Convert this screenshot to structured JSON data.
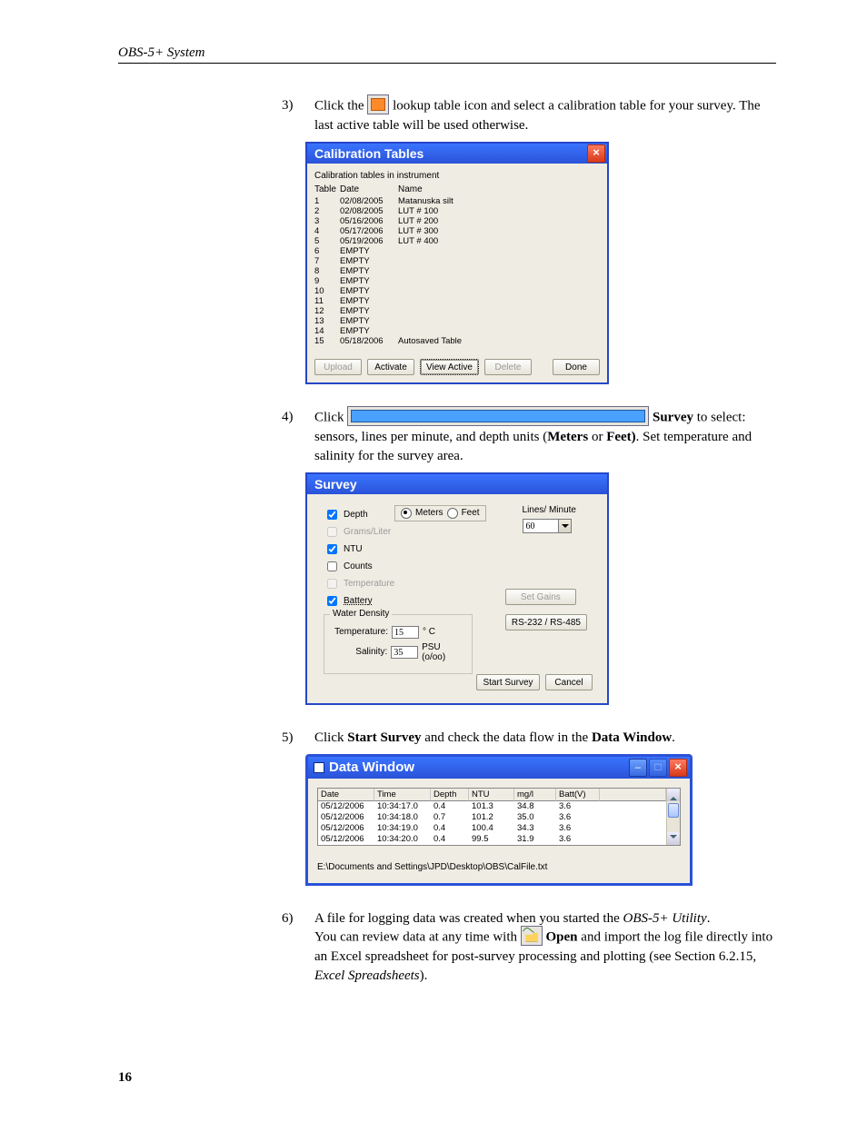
{
  "page": {
    "running_head": "OBS-5+ System",
    "page_number": "16"
  },
  "steps": {
    "s3": {
      "num": "3)",
      "pre": "Click the ",
      "post": " lookup table icon and select a calibration table for your survey. The last active table will be used otherwise."
    },
    "s4": {
      "num": "4)",
      "pre": "Click ",
      "survey_word": "Survey",
      "mid": " to select: sensors, lines per minute, and depth units (",
      "meters": "Meters",
      "or": " or ",
      "feet": "Feet)",
      "post": ". Set temperature and salinity for the survey area."
    },
    "s5": {
      "num": "5)",
      "pre": "Click ",
      "bold1": "Start Survey",
      "mid": " and check the data flow in the ",
      "bold2": "Data Window",
      "post": "."
    },
    "s6": {
      "num": "6)",
      "line1_pre": "A file for logging data was created when you started the ",
      "line1_ital": "OBS-5+ Utility",
      "line1_post": ".",
      "line2_pre": "You can review data at any time with ",
      "open_word": "Open",
      "line2_mid": " and import the log file directly into an Excel spreadsheet for post-survey processing and plotting (see Section 6.2.15, ",
      "line2_ital": "Excel Spreadsheets",
      "line2_post": ")."
    }
  },
  "cal": {
    "title": "Calibration Tables",
    "subtitle": "Calibration tables in instrument",
    "headers": {
      "c1": "Table",
      "c2": "Date",
      "c3": "Name"
    },
    "rows": [
      {
        "n": "1",
        "date": "02/08/2005",
        "name": "Matanuska silt"
      },
      {
        "n": "2",
        "date": "02/08/2005",
        "name": "LUT # 100"
      },
      {
        "n": "3",
        "date": "05/16/2006",
        "name": "LUT # 200"
      },
      {
        "n": "4",
        "date": "05/17/2006",
        "name": "LUT # 300"
      },
      {
        "n": "5",
        "date": "05/19/2006",
        "name": "LUT # 400"
      },
      {
        "n": "6",
        "date": "EMPTY",
        "name": ""
      },
      {
        "n": "7",
        "date": "EMPTY",
        "name": ""
      },
      {
        "n": "8",
        "date": "EMPTY",
        "name": ""
      },
      {
        "n": "9",
        "date": "EMPTY",
        "name": ""
      },
      {
        "n": "10",
        "date": "EMPTY",
        "name": ""
      },
      {
        "n": "11",
        "date": "EMPTY",
        "name": ""
      },
      {
        "n": "12",
        "date": "EMPTY",
        "name": ""
      },
      {
        "n": "13",
        "date": "EMPTY",
        "name": ""
      },
      {
        "n": "14",
        "date": "EMPTY",
        "name": ""
      },
      {
        "n": "15",
        "date": "05/18/2006",
        "name": "Autosaved Table"
      }
    ],
    "buttons": {
      "upload": "Upload",
      "activate": "Activate",
      "view": "View Active",
      "delete": "Delete",
      "done": "Done"
    }
  },
  "survey": {
    "title": "Survey",
    "checks": {
      "depth": "Depth",
      "grams": "Grams/Liter",
      "ntu": "NTU",
      "counts": "Counts",
      "temp": "Temperature",
      "batt": "Battery"
    },
    "units": {
      "meters": "Meters",
      "feet": "Feet"
    },
    "lines_label": "Lines/ Minute",
    "lines_value": "60",
    "water_density_legend": "Water Density",
    "temperature_label": "Temperature:",
    "temperature_value": "15",
    "temperature_unit": "° C",
    "salinity_label": "Salinity:",
    "salinity_value": "35",
    "salinity_unit": "PSU (o/oo)",
    "buttons": {
      "gains": "Set Gains",
      "rs": "RS-232 / RS-485",
      "start": "Start Survey",
      "cancel": "Cancel"
    }
  },
  "dw": {
    "title": "Data Window",
    "headers": {
      "date": "Date",
      "time": "Time",
      "depth": "Depth",
      "ntu": "NTU",
      "mgl": "mg/l",
      "batt": "Batt(V)"
    },
    "rows": [
      {
        "date": "05/12/2006",
        "time": "10:34:17.0",
        "depth": "0.4",
        "ntu": "101.3",
        "mgl": "34.8",
        "batt": "3.6"
      },
      {
        "date": "05/12/2006",
        "time": "10:34:18.0",
        "depth": "0.7",
        "ntu": "101.2",
        "mgl": "35.0",
        "batt": "3.6"
      },
      {
        "date": "05/12/2006",
        "time": "10:34:19.0",
        "depth": "0.4",
        "ntu": "100.4",
        "mgl": "34.3",
        "batt": "3.6"
      },
      {
        "date": "05/12/2006",
        "time": "10:34:20.0",
        "depth": "0.4",
        "ntu": "99.5",
        "mgl": "31.9",
        "batt": "3.6"
      }
    ],
    "path": "E:\\Documents and Settings\\JPD\\Desktop\\OBS\\CalFile.txt"
  }
}
